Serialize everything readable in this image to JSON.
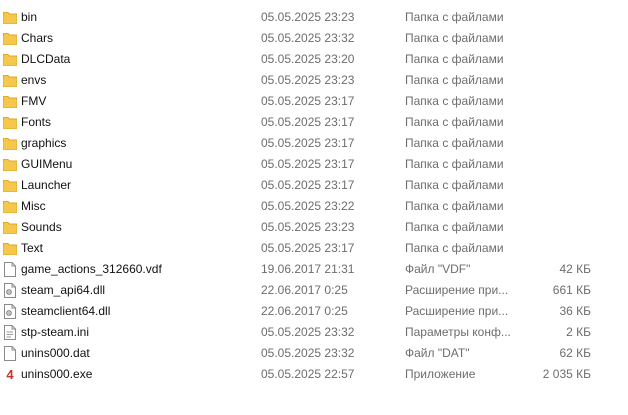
{
  "files": [
    {
      "name": "bin",
      "date": "05.05.2025 23:23",
      "type": "Папка с файлами",
      "size": "",
      "icon": "folder-icon"
    },
    {
      "name": "Chars",
      "date": "05.05.2025 23:32",
      "type": "Папка с файлами",
      "size": "",
      "icon": "folder-icon"
    },
    {
      "name": "DLCData",
      "date": "05.05.2025 23:20",
      "type": "Папка с файлами",
      "size": "",
      "icon": "folder-icon"
    },
    {
      "name": "envs",
      "date": "05.05.2025 23:23",
      "type": "Папка с файлами",
      "size": "",
      "icon": "folder-icon"
    },
    {
      "name": "FMV",
      "date": "05.05.2025 23:17",
      "type": "Папка с файлами",
      "size": "",
      "icon": "folder-icon"
    },
    {
      "name": "Fonts",
      "date": "05.05.2025 23:17",
      "type": "Папка с файлами",
      "size": "",
      "icon": "folder-icon"
    },
    {
      "name": "graphics",
      "date": "05.05.2025 23:17",
      "type": "Папка с файлами",
      "size": "",
      "icon": "folder-icon"
    },
    {
      "name": "GUIMenu",
      "date": "05.05.2025 23:17",
      "type": "Папка с файлами",
      "size": "",
      "icon": "folder-icon"
    },
    {
      "name": "Launcher",
      "date": "05.05.2025 23:17",
      "type": "Папка с файлами",
      "size": "",
      "icon": "folder-icon"
    },
    {
      "name": "Misc",
      "date": "05.05.2025 23:22",
      "type": "Папка с файлами",
      "size": "",
      "icon": "folder-icon"
    },
    {
      "name": "Sounds",
      "date": "05.05.2025 23:23",
      "type": "Папка с файлами",
      "size": "",
      "icon": "folder-icon"
    },
    {
      "name": "Text",
      "date": "05.05.2025 23:17",
      "type": "Папка с файлами",
      "size": "",
      "icon": "folder-icon"
    },
    {
      "name": "game_actions_312660.vdf",
      "date": "19.06.2017 21:31",
      "type": "Файл \"VDF\"",
      "size": "42 КБ",
      "icon": "file-icon"
    },
    {
      "name": "steam_api64.dll",
      "date": "22.06.2017 0:25",
      "type": "Расширение при...",
      "size": "661 КБ",
      "icon": "dll-icon"
    },
    {
      "name": "steamclient64.dll",
      "date": "22.06.2017 0:25",
      "type": "Расширение при...",
      "size": "36 КБ",
      "icon": "dll-icon"
    },
    {
      "name": "stp-steam.ini",
      "date": "05.05.2025 23:32",
      "type": "Параметры конф...",
      "size": "2 КБ",
      "icon": "settings-file-icon"
    },
    {
      "name": "unins000.dat",
      "date": "05.05.2025 23:32",
      "type": "Файл \"DAT\"",
      "size": "62 КБ",
      "icon": "file-icon"
    },
    {
      "name": "unins000.exe",
      "date": "05.05.2025 22:57",
      "type": "Приложение",
      "size": "2 035 КБ",
      "icon": "exe-icon"
    }
  ],
  "colors": {
    "folder": "#f5c84c",
    "folder_dark": "#e0a92e",
    "exe": "#c0392b"
  }
}
